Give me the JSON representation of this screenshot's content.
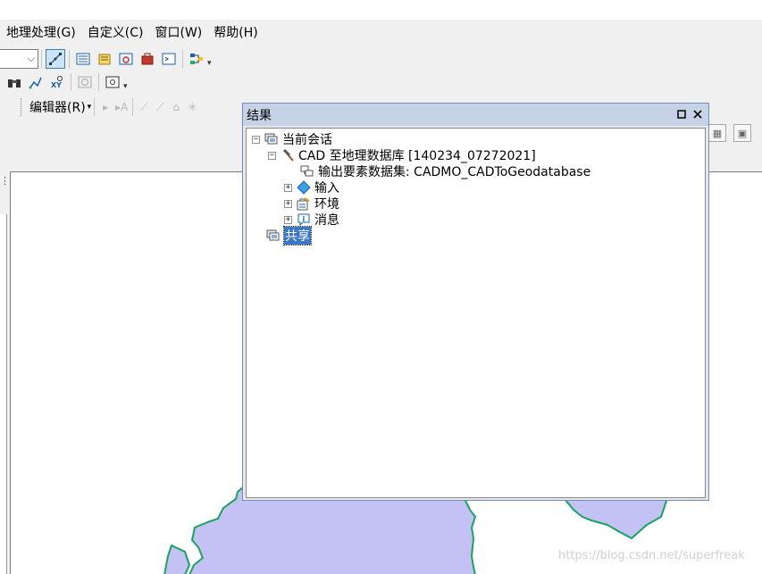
{
  "menubar": {
    "items": [
      "地理处理(G)",
      "自定义(C)",
      "窗口(W)",
      "帮助(H)"
    ]
  },
  "toolbar": {
    "editor_label": "编辑器(R)"
  },
  "results_window": {
    "title": "结果",
    "tree": {
      "current_session": "当前会话",
      "tool_run": "CAD 至地理数据库 [140234_07272021]",
      "output": "输出要素数据集: CADMO_CADToGeodatabase",
      "input": "输入",
      "environment": "环境",
      "messages": "消息",
      "shared": "共享"
    }
  },
  "colors": {
    "polygon_fill": "#c4c2f5",
    "polygon_outline": "#1aa35e",
    "selection": "#3c78c3",
    "title_bar": "#c6d3e6"
  },
  "watermark": "https://blog.csdn.net/superfreak"
}
